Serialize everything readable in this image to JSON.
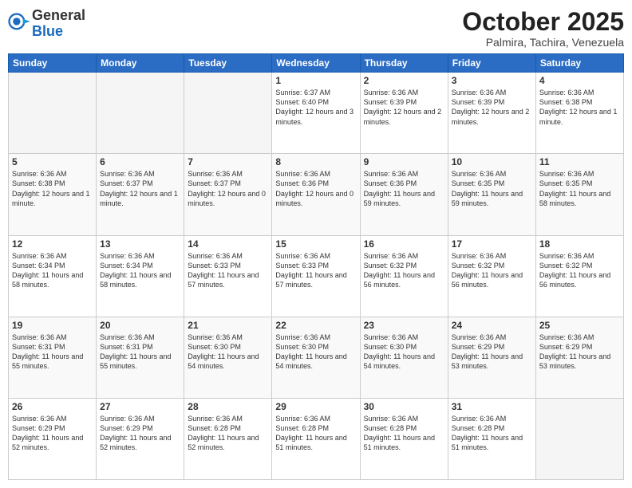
{
  "logo": {
    "general": "General",
    "blue": "Blue"
  },
  "title": "October 2025",
  "location": "Palmira, Tachira, Venezuela",
  "days_header": [
    "Sunday",
    "Monday",
    "Tuesday",
    "Wednesday",
    "Thursday",
    "Friday",
    "Saturday"
  ],
  "weeks": [
    [
      {
        "day": "",
        "info": ""
      },
      {
        "day": "",
        "info": ""
      },
      {
        "day": "",
        "info": ""
      },
      {
        "day": "1",
        "info": "Sunrise: 6:37 AM\nSunset: 6:40 PM\nDaylight: 12 hours and 3 minutes."
      },
      {
        "day": "2",
        "info": "Sunrise: 6:36 AM\nSunset: 6:39 PM\nDaylight: 12 hours and 2 minutes."
      },
      {
        "day": "3",
        "info": "Sunrise: 6:36 AM\nSunset: 6:39 PM\nDaylight: 12 hours and 2 minutes."
      },
      {
        "day": "4",
        "info": "Sunrise: 6:36 AM\nSunset: 6:38 PM\nDaylight: 12 hours and 1 minute."
      }
    ],
    [
      {
        "day": "5",
        "info": "Sunrise: 6:36 AM\nSunset: 6:38 PM\nDaylight: 12 hours and 1 minute."
      },
      {
        "day": "6",
        "info": "Sunrise: 6:36 AM\nSunset: 6:37 PM\nDaylight: 12 hours and 1 minute."
      },
      {
        "day": "7",
        "info": "Sunrise: 6:36 AM\nSunset: 6:37 PM\nDaylight: 12 hours and 0 minutes."
      },
      {
        "day": "8",
        "info": "Sunrise: 6:36 AM\nSunset: 6:36 PM\nDaylight: 12 hours and 0 minutes."
      },
      {
        "day": "9",
        "info": "Sunrise: 6:36 AM\nSunset: 6:36 PM\nDaylight: 11 hours and 59 minutes."
      },
      {
        "day": "10",
        "info": "Sunrise: 6:36 AM\nSunset: 6:35 PM\nDaylight: 11 hours and 59 minutes."
      },
      {
        "day": "11",
        "info": "Sunrise: 6:36 AM\nSunset: 6:35 PM\nDaylight: 11 hours and 58 minutes."
      }
    ],
    [
      {
        "day": "12",
        "info": "Sunrise: 6:36 AM\nSunset: 6:34 PM\nDaylight: 11 hours and 58 minutes."
      },
      {
        "day": "13",
        "info": "Sunrise: 6:36 AM\nSunset: 6:34 PM\nDaylight: 11 hours and 58 minutes."
      },
      {
        "day": "14",
        "info": "Sunrise: 6:36 AM\nSunset: 6:33 PM\nDaylight: 11 hours and 57 minutes."
      },
      {
        "day": "15",
        "info": "Sunrise: 6:36 AM\nSunset: 6:33 PM\nDaylight: 11 hours and 57 minutes."
      },
      {
        "day": "16",
        "info": "Sunrise: 6:36 AM\nSunset: 6:32 PM\nDaylight: 11 hours and 56 minutes."
      },
      {
        "day": "17",
        "info": "Sunrise: 6:36 AM\nSunset: 6:32 PM\nDaylight: 11 hours and 56 minutes."
      },
      {
        "day": "18",
        "info": "Sunrise: 6:36 AM\nSunset: 6:32 PM\nDaylight: 11 hours and 56 minutes."
      }
    ],
    [
      {
        "day": "19",
        "info": "Sunrise: 6:36 AM\nSunset: 6:31 PM\nDaylight: 11 hours and 55 minutes."
      },
      {
        "day": "20",
        "info": "Sunrise: 6:36 AM\nSunset: 6:31 PM\nDaylight: 11 hours and 55 minutes."
      },
      {
        "day": "21",
        "info": "Sunrise: 6:36 AM\nSunset: 6:30 PM\nDaylight: 11 hours and 54 minutes."
      },
      {
        "day": "22",
        "info": "Sunrise: 6:36 AM\nSunset: 6:30 PM\nDaylight: 11 hours and 54 minutes."
      },
      {
        "day": "23",
        "info": "Sunrise: 6:36 AM\nSunset: 6:30 PM\nDaylight: 11 hours and 54 minutes."
      },
      {
        "day": "24",
        "info": "Sunrise: 6:36 AM\nSunset: 6:29 PM\nDaylight: 11 hours and 53 minutes."
      },
      {
        "day": "25",
        "info": "Sunrise: 6:36 AM\nSunset: 6:29 PM\nDaylight: 11 hours and 53 minutes."
      }
    ],
    [
      {
        "day": "26",
        "info": "Sunrise: 6:36 AM\nSunset: 6:29 PM\nDaylight: 11 hours and 52 minutes."
      },
      {
        "day": "27",
        "info": "Sunrise: 6:36 AM\nSunset: 6:29 PM\nDaylight: 11 hours and 52 minutes."
      },
      {
        "day": "28",
        "info": "Sunrise: 6:36 AM\nSunset: 6:28 PM\nDaylight: 11 hours and 52 minutes."
      },
      {
        "day": "29",
        "info": "Sunrise: 6:36 AM\nSunset: 6:28 PM\nDaylight: 11 hours and 51 minutes."
      },
      {
        "day": "30",
        "info": "Sunrise: 6:36 AM\nSunset: 6:28 PM\nDaylight: 11 hours and 51 minutes."
      },
      {
        "day": "31",
        "info": "Sunrise: 6:36 AM\nSunset: 6:28 PM\nDaylight: 11 hours and 51 minutes."
      },
      {
        "day": "",
        "info": ""
      }
    ]
  ]
}
